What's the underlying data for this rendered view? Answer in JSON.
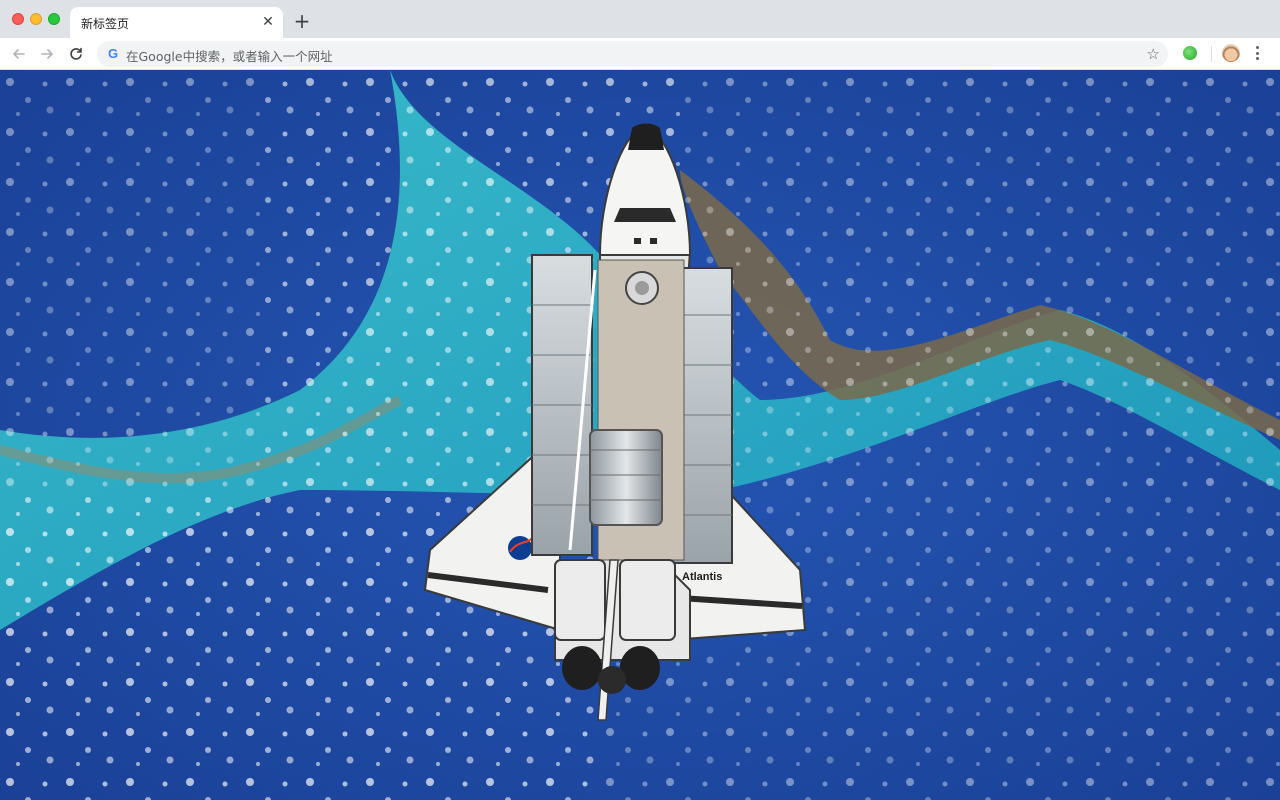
{
  "window": {
    "tab_title": "新标签页",
    "tab_close_glyph": "✕",
    "new_tab_glyph": "+"
  },
  "toolbar": {
    "omnibox_placeholder": "在Google中搜索，或者输入一个网址",
    "google_glyph": "G",
    "star_glyph": "☆"
  },
  "content": {
    "background_image_label": "Atlantis",
    "colors": {
      "ocean_deep": "#1f4aa3",
      "shallow_water": "#2bb3c4",
      "land": "#7a6a4a"
    }
  },
  "icons": [
    "back-arrow-icon",
    "forward-arrow-icon",
    "reload-icon",
    "google-icon",
    "bookmark-star-icon",
    "extension-icon",
    "profile-avatar-icon",
    "menu-dots-icon"
  ]
}
